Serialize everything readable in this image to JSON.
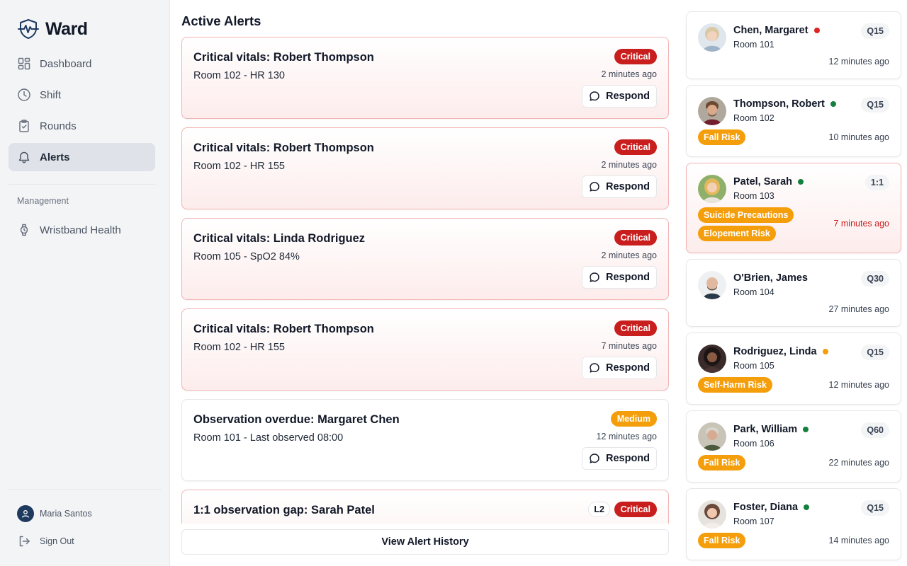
{
  "app": {
    "name": "Ward"
  },
  "sidebar": {
    "items": [
      {
        "label": "Dashboard",
        "icon": "grid-icon"
      },
      {
        "label": "Shift",
        "icon": "clock-icon"
      },
      {
        "label": "Rounds",
        "icon": "clipboard-check-icon"
      },
      {
        "label": "Alerts",
        "icon": "bell-icon",
        "active": true
      }
    ],
    "section_label": "Management",
    "management_items": [
      {
        "label": "Wristband Health",
        "icon": "watch-icon"
      }
    ],
    "user_name": "Maria Santos",
    "sign_out": "Sign Out"
  },
  "main": {
    "title": "Active Alerts",
    "alerts": [
      {
        "title": "Critical vitals: Robert Thompson",
        "subtitle": "Room 102 - HR 130",
        "severity": "Critical",
        "time": "2 minutes ago",
        "action": "Respond"
      },
      {
        "title": "Critical vitals: Robert Thompson",
        "subtitle": "Room 102 - HR 155",
        "severity": "Critical",
        "time": "2 minutes ago",
        "action": "Respond"
      },
      {
        "title": "Critical vitals: Linda Rodriguez",
        "subtitle": "Room 105 - SpO2 84%",
        "severity": "Critical",
        "time": "2 minutes ago",
        "action": "Respond"
      },
      {
        "title": "Critical vitals: Robert Thompson",
        "subtitle": "Room 102 - HR 155",
        "severity": "Critical",
        "time": "7 minutes ago",
        "action": "Respond"
      },
      {
        "title": "Observation overdue: Margaret Chen",
        "subtitle": "Room 101 - Last observed 08:00",
        "severity": "Medium",
        "time": "12 minutes ago",
        "action": "Respond"
      },
      {
        "title": "1:1 observation gap: Sarah Patel",
        "subtitle": "",
        "severity": "Critical",
        "level": "L2",
        "time": "",
        "action": ""
      }
    ],
    "history_button": "View Alert History"
  },
  "patients": [
    {
      "name": "Chen, Margaret",
      "room": "Room 101",
      "frequency": "Q15",
      "status": "red",
      "tags": [],
      "time": "12 minutes ago"
    },
    {
      "name": "Thompson, Robert",
      "room": "Room 102",
      "frequency": "Q15",
      "status": "green",
      "tags": [
        "Fall Risk"
      ],
      "time": "10 minutes ago"
    },
    {
      "name": "Patel, Sarah",
      "room": "Room 103",
      "frequency": "1:1",
      "status": "green",
      "tags": [
        "Suicide Precautions",
        "Elopement Risk"
      ],
      "time": "7 minutes ago",
      "alert": true
    },
    {
      "name": "O'Brien, James",
      "room": "Room 104",
      "frequency": "Q30",
      "status": "none",
      "tags": [],
      "time": "27 minutes ago"
    },
    {
      "name": "Rodriguez, Linda",
      "room": "Room 105",
      "frequency": "Q15",
      "status": "amber",
      "tags": [
        "Self-Harm Risk"
      ],
      "time": "12 minutes ago"
    },
    {
      "name": "Park, William",
      "room": "Room 106",
      "frequency": "Q60",
      "status": "green",
      "tags": [
        "Fall Risk"
      ],
      "time": "22 minutes ago"
    },
    {
      "name": "Foster, Diana",
      "room": "Room 107",
      "frequency": "Q15",
      "status": "green",
      "tags": [
        "Fall Risk"
      ],
      "time": "14 minutes ago"
    }
  ],
  "colors": {
    "critical": "#c81e1e",
    "medium": "#f59e0b",
    "status_red": "#dc2626",
    "status_green": "#15803d",
    "status_amber": "#f59e0b",
    "active_nav_bg": "#dfe2e8"
  }
}
